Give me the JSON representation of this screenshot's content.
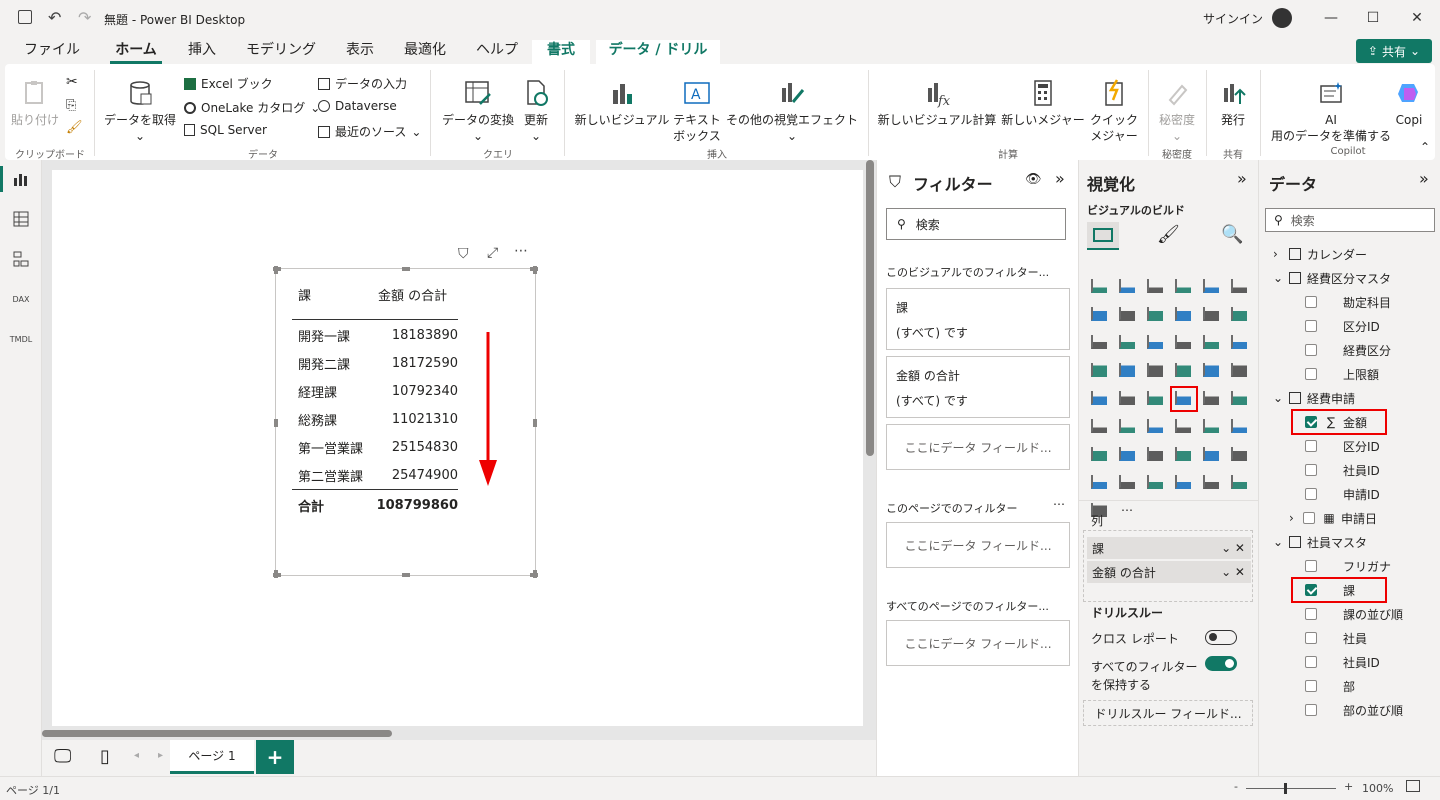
{
  "window": {
    "title": "無題 - Power BI Desktop",
    "signin": "サインイン"
  },
  "menu": {
    "tabs": [
      "ファイル",
      "ホーム",
      "挿入",
      "モデリング",
      "表示",
      "最適化",
      "ヘルプ",
      "書式",
      "データ / ドリル"
    ],
    "share": "共有"
  },
  "ribbon": {
    "paste": "貼り付け",
    "clipboard_group": "クリップボード",
    "get_data": "データを取得",
    "excel": "Excel ブック",
    "onelake": "OneLake カタログ",
    "sql": "SQL Server",
    "enter_data": "データの入力",
    "dataverse": "Dataverse",
    "recent": "最近のソース",
    "data_group": "データ",
    "transform": "データの変換",
    "refresh": "更新",
    "query_group": "クエリ",
    "new_visual": "新しいビジュアル",
    "textbox_l1": "テキスト",
    "textbox_l2": "ボックス",
    "more_visuals": "その他の視覚エフェクト",
    "insert_group": "挿入",
    "new_visual_calc": "新しいビジュアル計算",
    "new_measure": "新しいメジャー",
    "quick_l1": "クイック",
    "quick_l2": "メジャー",
    "calc_group": "計算",
    "sensitivity": "秘密度",
    "sensitivity_group": "秘密度",
    "publish": "発行",
    "share_group": "共有",
    "ai_l1": "AI",
    "ai_l2": "用のデータを準備する",
    "copilot": "Copi",
    "copilot_group": "Copilot"
  },
  "visual": {
    "headers": [
      "課",
      "金額 の合計"
    ],
    "rows": [
      {
        "name": "開発一課",
        "value": "18183890"
      },
      {
        "name": "開発二課",
        "value": "18172590"
      },
      {
        "name": "経理課",
        "value": "10792340"
      },
      {
        "name": "総務課",
        "value": "11021310"
      },
      {
        "name": "第一営業課",
        "value": "25154830"
      },
      {
        "name": "第二営業課",
        "value": "25474900"
      }
    ],
    "total_label": "合計",
    "total_value": "108799860"
  },
  "pages": {
    "tab": "ページ 1",
    "status": "ページ 1/1",
    "zoom": "100%"
  },
  "filters": {
    "title": "フィルター",
    "search": "検索",
    "visual_section": "このビジュアルでのフィルター...",
    "card1_title": "課",
    "card1_value": "(すべて) です",
    "card2_title": "金額 の合計",
    "card2_value": "(すべて) です",
    "drop": "ここにデータ フィールド...",
    "page_section": "このページでのフィルター",
    "all_section": "すべてのページでのフィルター..."
  },
  "viz": {
    "title": "視覚化",
    "build": "ビジュアルのビルド",
    "columns": "列",
    "wells": [
      "課",
      "金額 の合計"
    ],
    "drill": "ドリルスルー",
    "cross": "クロス レポート",
    "keep_l1": "すべてのフィルター",
    "keep_l2": "を保持する",
    "drill_field": "ドリルスルー フィールド..."
  },
  "data": {
    "title": "データ",
    "search": "検索",
    "items": [
      {
        "label": "カレンダー",
        "kind": "table",
        "indent": 0,
        "expanded": false
      },
      {
        "label": "経費区分マスタ",
        "kind": "table",
        "indent": 0,
        "expanded": true
      },
      {
        "label": "勘定科目",
        "kind": "field",
        "indent": 1,
        "checked": false
      },
      {
        "label": "区分ID",
        "kind": "field",
        "indent": 1,
        "checked": false
      },
      {
        "label": "経費区分",
        "kind": "field",
        "indent": 1,
        "checked": false
      },
      {
        "label": "上限額",
        "kind": "field",
        "indent": 1,
        "checked": false
      },
      {
        "label": "経費申請",
        "kind": "table",
        "indent": 0,
        "expanded": true
      },
      {
        "label": "金額",
        "kind": "sum",
        "indent": 1,
        "checked": true
      },
      {
        "label": "区分ID",
        "kind": "field",
        "indent": 1,
        "checked": false
      },
      {
        "label": "社員ID",
        "kind": "field",
        "indent": 1,
        "checked": false
      },
      {
        "label": "申請ID",
        "kind": "field",
        "indent": 1,
        "checked": false
      },
      {
        "label": "申請日",
        "kind": "date",
        "indent": 1,
        "checked": false
      },
      {
        "label": "社員マスタ",
        "kind": "table",
        "indent": 0,
        "expanded": true
      },
      {
        "label": "フリガナ",
        "kind": "field",
        "indent": 1,
        "checked": false
      },
      {
        "label": "課",
        "kind": "field",
        "indent": 1,
        "checked": true
      },
      {
        "label": "課の並び順",
        "kind": "field",
        "indent": 1,
        "checked": false
      },
      {
        "label": "社員",
        "kind": "field",
        "indent": 1,
        "checked": false
      },
      {
        "label": "社員ID",
        "kind": "field",
        "indent": 1,
        "checked": false
      },
      {
        "label": "部",
        "kind": "field",
        "indent": 1,
        "checked": false
      },
      {
        "label": "部の並び順",
        "kind": "field",
        "indent": 1,
        "checked": false
      }
    ]
  },
  "colors": {
    "accent": "#117865",
    "highlight": "#e00000"
  }
}
